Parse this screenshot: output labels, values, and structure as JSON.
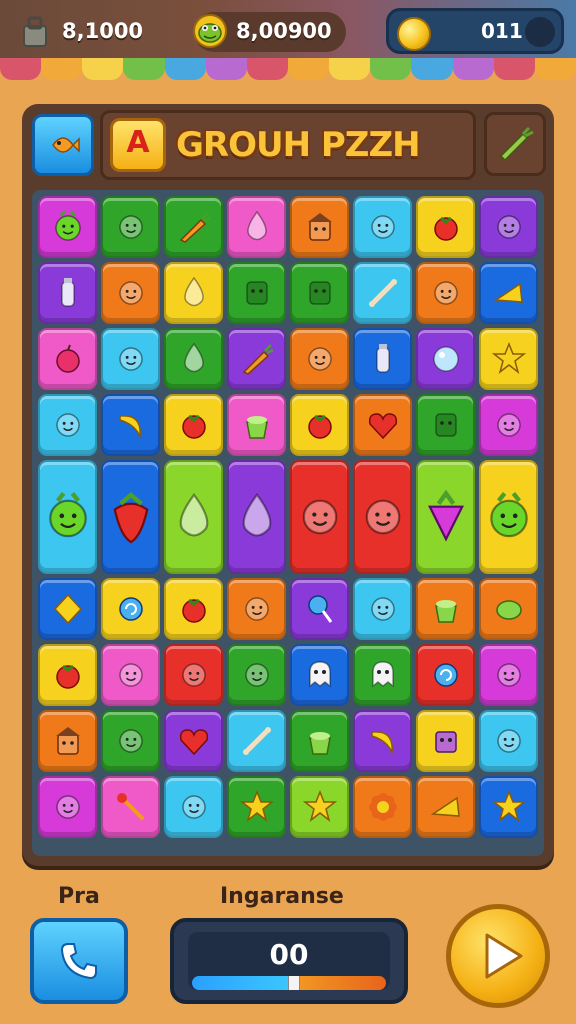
{
  "header": {
    "stat_left": "8,1000",
    "stat_middle": "8,00900",
    "coins": "011"
  },
  "board": {
    "title": "GROUH PZZH",
    "title_badge": "A"
  },
  "bottom": {
    "left_label": "Pra",
    "center_label": "Ingaranse",
    "meter_value": "00",
    "meter_progress": 0.52
  },
  "colors": {
    "board_frame": "#5a3c2c",
    "gold_title": "#f9c43a",
    "accent_blue": "#1a8ee0",
    "accent_yellow": "#f5b014"
  },
  "tiles": [
    [
      "magenta-frog",
      "green-face",
      "green-carrot",
      "pink-drop",
      "orange-house",
      "cyan-face",
      "yellow-berry",
      "purple-face"
    ],
    [
      "purple-bottle",
      "orange-face",
      "yellow-drop",
      "green-toast",
      "green-block",
      "cyan-bone",
      "orange-face",
      "blue-cheese"
    ],
    [
      "pink-apple",
      "cyan-face",
      "green-drop",
      "purple-carrot",
      "orange-face",
      "blue-bottle",
      "purple-ball",
      "yellow-star"
    ],
    [
      "cyan-face",
      "blue-banana",
      "yellow-berry",
      "pink-cake",
      "yellow-berry",
      "orange-heart",
      "green-block",
      "magenta-face"
    ],
    [
      "cyan-frog",
      "blue-strawberry",
      "lime-drop",
      "purple-drop",
      "red-face",
      "red-face",
      "lime-cone",
      "yellow-frog"
    ],
    [
      "blue-diamond",
      "yellow-swirl",
      "yellow-berry",
      "orange-face",
      "purple-lollipop",
      "cyan-face",
      "orange-cake",
      "orange-leaf"
    ],
    [
      "yellow-berry",
      "pink-face",
      "red-face",
      "green-face",
      "blue-skull",
      "green-ghost",
      "red-swirl",
      "magenta-face"
    ],
    [
      "orange-house",
      "green-face",
      "purple-heart",
      "cyan-bone",
      "green-cake",
      "purple-banana",
      "yellow-robot",
      "cyan-face"
    ],
    [
      "magenta-face",
      "pink-wand",
      "cyan-face",
      "green-star",
      "lime-star",
      "orange-flower",
      "orange-cheese",
      "blue-star"
    ]
  ],
  "icons": [
    "bag-icon",
    "frog-coin-icon",
    "coin-icon",
    "carrot-icon",
    "phone-icon",
    "play-icon",
    "fish-icon"
  ]
}
